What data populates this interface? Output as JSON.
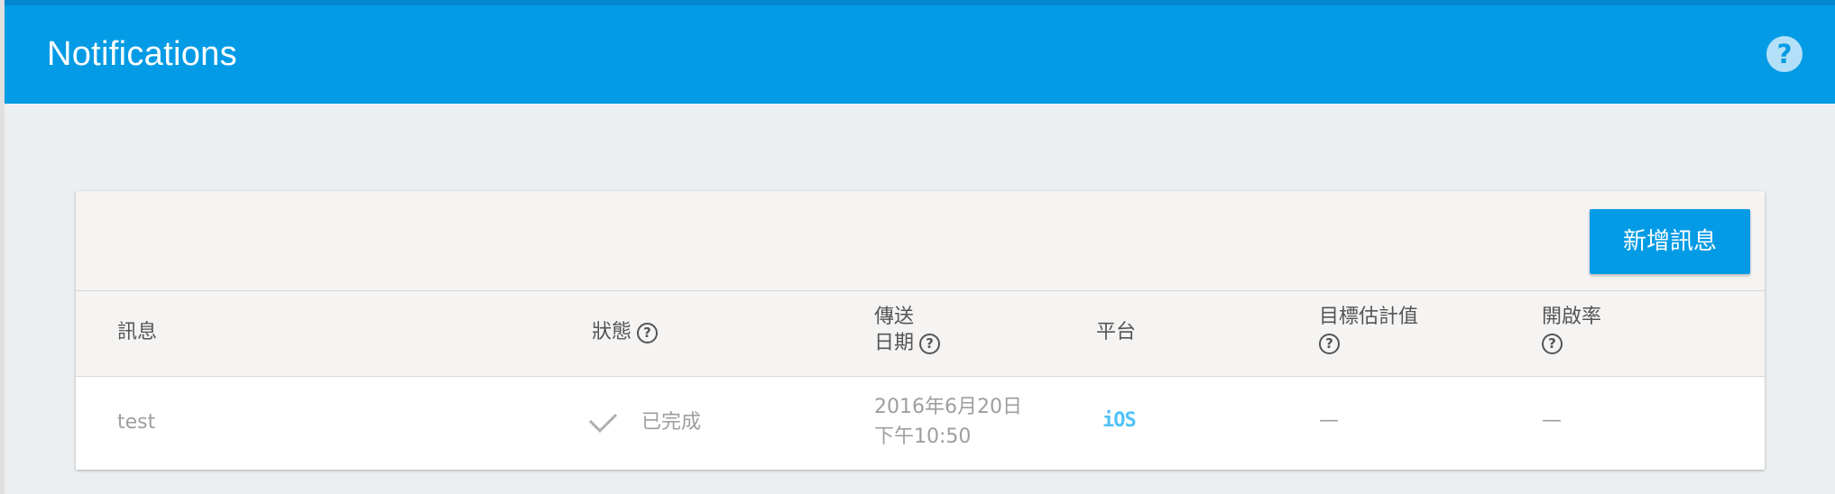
{
  "header": {
    "title": "Notifications",
    "help_icon": "?"
  },
  "toolbar": {
    "new_message_label": "新增訊息"
  },
  "table": {
    "columns": {
      "message": "訊息",
      "status": "狀態",
      "send_date_line1": "傳送",
      "send_date_line2": "日期",
      "platform": "平台",
      "target_estimate": "目標估計值",
      "open_rate": "開啟率"
    },
    "help_glyph": "?",
    "rows": [
      {
        "message": "test",
        "status": "已完成",
        "date_line1": "2016年6月20日",
        "date_line2": "下午10:50",
        "platform": "iOS",
        "target_estimate": "—",
        "open_rate": "—"
      }
    ]
  },
  "colors": {
    "primary": "#039be5",
    "background": "#eceff1",
    "ios_accent": "#4fc3f7"
  },
  "icons": {
    "help": "question-circle-icon",
    "status_done": "check-icon",
    "platform": "ios-icon"
  }
}
